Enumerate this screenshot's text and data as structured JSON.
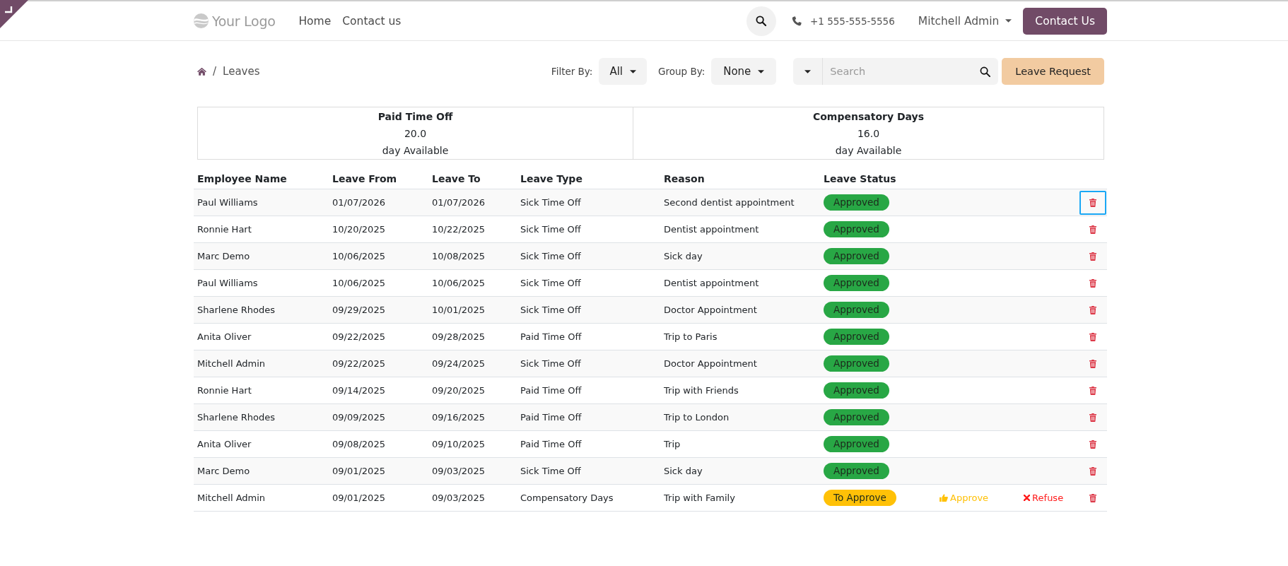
{
  "header": {
    "logo": "Your Logo",
    "nav": [
      {
        "label": "Home"
      },
      {
        "label": "Contact us"
      }
    ],
    "phone": "+1 555-555-5556",
    "user": "Mitchell Admin",
    "cta": "Contact Us"
  },
  "breadcrumb": {
    "separator": "/",
    "current": "Leaves"
  },
  "filters": {
    "filter_label": "Filter By:",
    "filter_value": "All",
    "group_label": "Group By:",
    "group_value": "None",
    "search": {
      "placeholder": "Search"
    },
    "new_button": "Leave Request"
  },
  "allocations": [
    {
      "name": "Paid Time Off",
      "amount": "20.0",
      "unit": "day Available"
    },
    {
      "name": "Compensatory Days",
      "amount": "16.0",
      "unit": "day Available"
    }
  ],
  "table": {
    "columns": [
      "Employee Name",
      "Leave From",
      "Leave To",
      "Leave Type",
      "Reason",
      "Leave Status"
    ],
    "rows": [
      {
        "employee": "Paul Williams",
        "from": "01/07/2026",
        "to": "01/07/2026",
        "type": "Sick Time Off",
        "reason": "Second dentist appointment",
        "status": {
          "label": "Approved",
          "color": "#28a745"
        },
        "delete_focused": true
      },
      {
        "employee": "Ronnie Hart",
        "from": "10/20/2025",
        "to": "10/22/2025",
        "type": "Sick Time Off",
        "reason": "Dentist appointment",
        "status": {
          "label": "Approved",
          "color": "#28a745"
        },
        "delete_focused": false
      },
      {
        "employee": "Marc Demo",
        "from": "10/06/2025",
        "to": "10/08/2025",
        "type": "Sick Time Off",
        "reason": "Sick day",
        "status": {
          "label": "Approved",
          "color": "#28a745"
        },
        "delete_focused": false
      },
      {
        "employee": "Paul Williams",
        "from": "10/06/2025",
        "to": "10/06/2025",
        "type": "Sick Time Off",
        "reason": "Dentist appointment",
        "status": {
          "label": "Approved",
          "color": "#28a745"
        },
        "delete_focused": false
      },
      {
        "employee": "Sharlene Rhodes",
        "from": "09/29/2025",
        "to": "10/01/2025",
        "type": "Sick Time Off",
        "reason": "Doctor Appointment",
        "status": {
          "label": "Approved",
          "color": "#28a745"
        },
        "delete_focused": false
      },
      {
        "employee": "Anita Oliver",
        "from": "09/22/2025",
        "to": "09/28/2025",
        "type": "Paid Time Off",
        "reason": "Trip to Paris",
        "status": {
          "label": "Approved",
          "color": "#28a745"
        },
        "delete_focused": false
      },
      {
        "employee": "Mitchell Admin",
        "from": "09/22/2025",
        "to": "09/24/2025",
        "type": "Sick Time Off",
        "reason": "Doctor Appointment",
        "status": {
          "label": "Approved",
          "color": "#28a745"
        },
        "delete_focused": false
      },
      {
        "employee": "Ronnie Hart",
        "from": "09/14/2025",
        "to": "09/20/2025",
        "type": "Paid Time Off",
        "reason": "Trip with Friends",
        "status": {
          "label": "Approved",
          "color": "#28a745"
        },
        "delete_focused": false
      },
      {
        "employee": "Sharlene Rhodes",
        "from": "09/09/2025",
        "to": "09/16/2025",
        "type": "Paid Time Off",
        "reason": "Trip to London",
        "status": {
          "label": "Approved",
          "color": "#28a745"
        },
        "delete_focused": false
      },
      {
        "employee": "Anita Oliver",
        "from": "09/08/2025",
        "to": "09/10/2025",
        "type": "Paid Time Off",
        "reason": "Trip",
        "status": {
          "label": "Approved",
          "color": "#28a745"
        },
        "delete_focused": false
      },
      {
        "employee": "Marc Demo",
        "from": "09/01/2025",
        "to": "09/03/2025",
        "type": "Sick Time Off",
        "reason": "Sick day",
        "status": {
          "label": "Approved",
          "color": "#28a745"
        },
        "delete_focused": false
      },
      {
        "employee": "Mitchell Admin",
        "from": "09/01/2025",
        "to": "09/03/2025",
        "type": "Compensatory Days",
        "reason": "Trip with Family",
        "status": {
          "label": "To Approve",
          "color": "#ffc107"
        },
        "actions": [
          {
            "kind": "approve",
            "label": "Approve"
          },
          {
            "kind": "refuse",
            "label": "Refuse"
          }
        ],
        "delete_focused": false
      }
    ]
  }
}
